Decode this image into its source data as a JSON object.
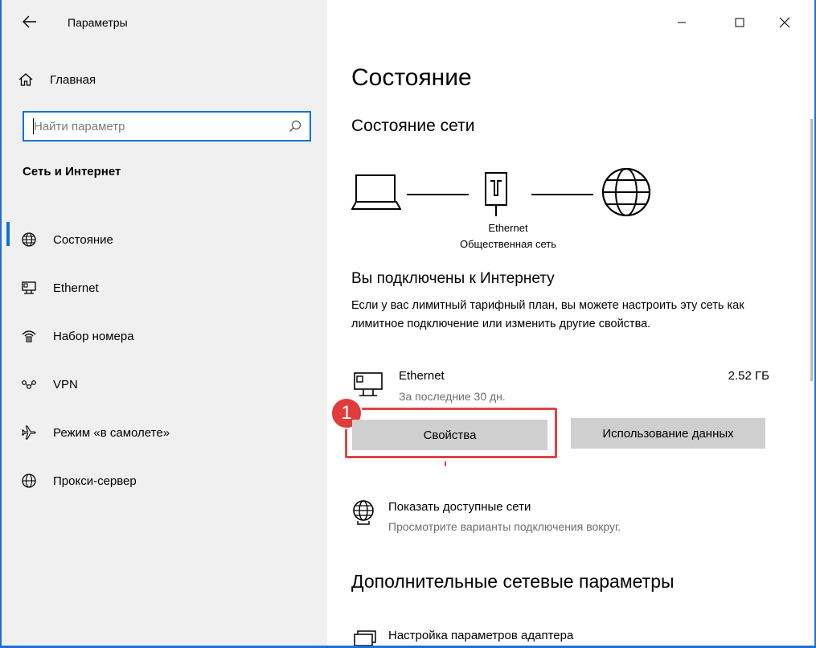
{
  "window": {
    "title": "Параметры"
  },
  "sidebar": {
    "home_label": "Главная",
    "search_placeholder": "Найти параметр",
    "section_title": "Сеть и Интернет",
    "items": [
      {
        "label": "Состояние",
        "icon": "globe-status-icon",
        "active": true
      },
      {
        "label": "Ethernet",
        "icon": "ethernet-icon",
        "active": false
      },
      {
        "label": "Набор номера",
        "icon": "dialup-icon",
        "active": false
      },
      {
        "label": "VPN",
        "icon": "vpn-icon",
        "active": false
      },
      {
        "label": "Режим «в самолете»",
        "icon": "airplane-icon",
        "active": false
      },
      {
        "label": "Прокси-сервер",
        "icon": "globe-icon",
        "active": false
      }
    ]
  },
  "main": {
    "page_title": "Состояние",
    "network_status_title": "Состояние сети",
    "diagram": {
      "adapter": "Ethernet",
      "network": "Общественная сеть"
    },
    "connected_title": "Вы подключены к Интернету",
    "description": "Если у вас лимитный тарифный план, вы можете настроить эту сеть как лимитное подключение или изменить другие свойства.",
    "adapter": {
      "name": "Ethernet",
      "period": "За последние 30 дн.",
      "usage": "2.52 ГБ"
    },
    "buttons": {
      "properties": "Свойства",
      "data_usage": "Использование данных"
    },
    "badge": "1",
    "show_networks": {
      "title": "Показать доступные сети",
      "subtitle": "Просмотрите варианты подключения вокруг."
    },
    "more_title": "Дополнительные сетевые параметры",
    "adapter_settings": "Настройка параметров адаптера"
  },
  "colors": {
    "accent": "#0a74d6",
    "highlight": "#e04444",
    "badge": "#e23b3b",
    "sidebar_bg": "#f0f0f0",
    "button_bg": "#cfcfcf"
  }
}
